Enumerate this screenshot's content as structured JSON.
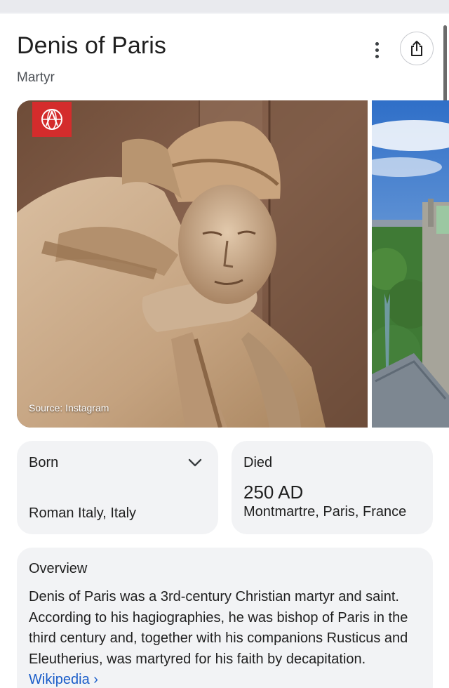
{
  "header": {
    "title": "Denis of Paris",
    "subtitle": "Martyr"
  },
  "images": {
    "main": {
      "source_label": "Source: Instagram",
      "description_icon": "statue-image"
    },
    "side": {
      "description_icon": "cathedral-image"
    }
  },
  "facts": {
    "born": {
      "label": "Born",
      "value": "Roman Italy, Italy"
    },
    "died": {
      "label": "Died",
      "year": "250 AD",
      "place": "Montmartre, Paris, France"
    }
  },
  "overview": {
    "title": "Overview",
    "text": "Denis of Paris was a 3rd-century Christian martyr and saint. According to his hagiographies, he was bishop of Paris in the third century and, together with his companions Rusticus and Eleutherius, was martyred for his faith by decapitation.",
    "link_label": "Wikipedia ›"
  },
  "colors": {
    "link": "#1a5dc9",
    "card_bg": "#f2f3f5",
    "logo_red": "#d42c2c"
  }
}
